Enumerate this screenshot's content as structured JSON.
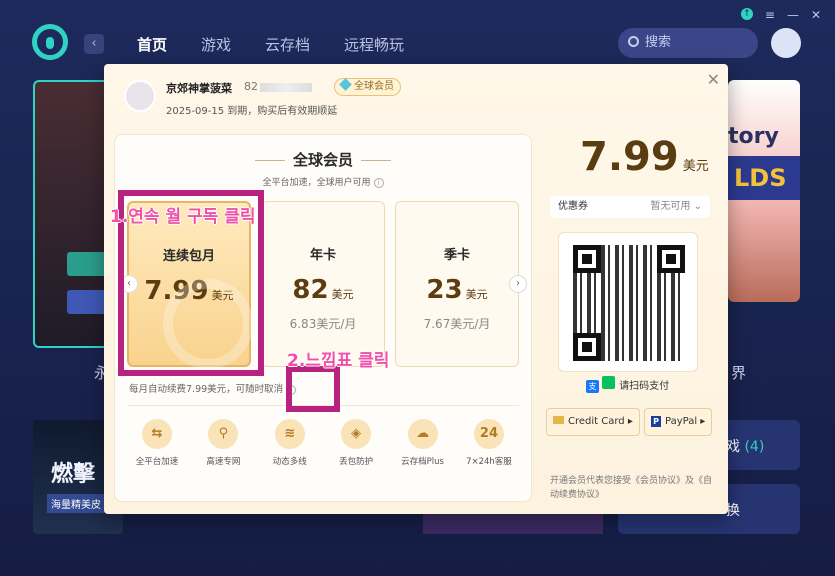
{
  "nav": {
    "items": [
      "首页",
      "游戏",
      "云存档",
      "远程畅玩"
    ],
    "active_index": 0,
    "search_placeholder": "搜索"
  },
  "background": {
    "left_char_text": "永",
    "right_char_text": "界",
    "bottom_left_title": "燃擊",
    "bottom_left_sub": "海量精美皮",
    "games_button": "戏",
    "games_count": "(4)",
    "switch_button": "换",
    "promo_text": "tory",
    "promo_banner": "LDS"
  },
  "modal": {
    "user_name": "京郊神掌菠菜",
    "user_id_prefix": "82",
    "vip_badge": "全球会员",
    "expire_text": "2025-09-15 到期，购买后有效期顺延",
    "panel_title": "全球会员",
    "panel_subtitle": "全平台加速，全球用户可用",
    "plans": [
      {
        "name": "连续包月",
        "price": "7.99",
        "unit": "美元",
        "per": ""
      },
      {
        "name": "年卡",
        "price": "82",
        "unit": "美元",
        "per": "6.83美元/月"
      },
      {
        "name": "季卡",
        "price": "23",
        "unit": "美元",
        "per": "7.67美元/月"
      }
    ],
    "selected_plan_index": 0,
    "auto_renew_note": "每月自动续费7.99美元，可随时取消",
    "perks": [
      "全平台加速",
      "高速专网",
      "动态多线",
      "丢包防护",
      "云存档Plus",
      "7×24h客服"
    ],
    "big_price": "7.99",
    "big_price_unit": "美元",
    "coupon_label": "优惠券",
    "coupon_value": "暂无可用",
    "scan_pay_text": "请扫码支付",
    "credit_card_label": "Credit Card ▸",
    "paypal_label": "PayPal ▸",
    "agreement_text": "开通会员代表您接受《会员协议》及《自动续费协议》"
  },
  "annotations": {
    "step1": "1.연속 월 구독 클릭",
    "step2": "2.느낌표 클릭",
    "color": "#b8237f"
  }
}
